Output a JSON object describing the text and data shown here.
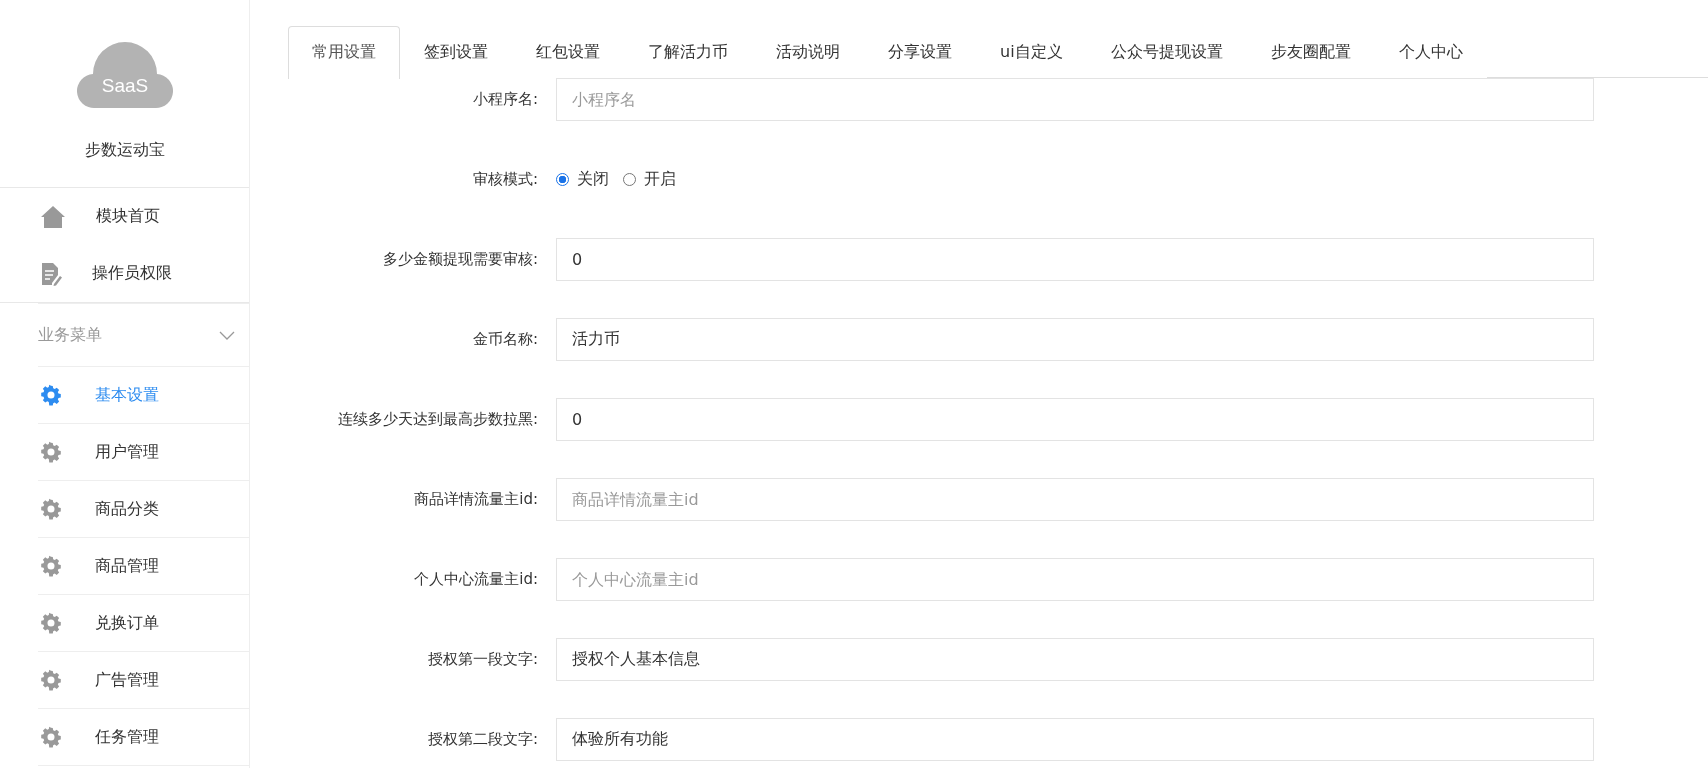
{
  "sidebar": {
    "logo_text": "SaaS",
    "app_name": "步数运动宝",
    "top_links": [
      {
        "label": "模块首页",
        "selected": false
      },
      {
        "label": "操作员权限",
        "selected": false
      }
    ],
    "group": {
      "label": "业务菜单",
      "expanded": true,
      "items": [
        {
          "label": "基本设置",
          "selected": true
        },
        {
          "label": "用户管理",
          "selected": false
        },
        {
          "label": "商品分类",
          "selected": false
        },
        {
          "label": "商品管理",
          "selected": false
        },
        {
          "label": "兑换订单",
          "selected": false
        },
        {
          "label": "广告管理",
          "selected": false
        },
        {
          "label": "任务管理",
          "selected": false
        }
      ]
    }
  },
  "tabs": [
    {
      "label": "常用设置",
      "selected": true
    },
    {
      "label": "签到设置",
      "selected": false
    },
    {
      "label": "红包设置",
      "selected": false
    },
    {
      "label": "了解活力币",
      "selected": false
    },
    {
      "label": "活动说明",
      "selected": false
    },
    {
      "label": "分享设置",
      "selected": false
    },
    {
      "label": "ui自定义",
      "selected": false
    },
    {
      "label": "公众号提现设置",
      "selected": false
    },
    {
      "label": "步友圈配置",
      "selected": false
    },
    {
      "label": "个人中心",
      "selected": false
    }
  ],
  "form": [
    {
      "kind": "text",
      "label": "小程序名:",
      "placeholder": "小程序名"
    },
    {
      "kind": "radio",
      "label": "审核模式:",
      "options": [
        {
          "label": "关闭",
          "selected": true
        },
        {
          "label": "开启",
          "selected": false
        }
      ]
    },
    {
      "kind": "text",
      "label": "多少金额提现需要审核:",
      "value": "0"
    },
    {
      "kind": "text",
      "label": "金币名称:",
      "value": "活力币"
    },
    {
      "kind": "text",
      "label": "连续多少天达到最高步数拉黑:",
      "value": "0"
    },
    {
      "kind": "text",
      "label": "商品详情流量主id:",
      "placeholder": "商品详情流量主id"
    },
    {
      "kind": "text",
      "label": "个人中心流量主id:",
      "placeholder": "个人中心流量主id"
    },
    {
      "kind": "text",
      "label": "授权第一段文字:",
      "value": "授权个人基本信息"
    },
    {
      "kind": "text",
      "label": "授权第二段文字:",
      "value": "体验所有功能"
    }
  ]
}
